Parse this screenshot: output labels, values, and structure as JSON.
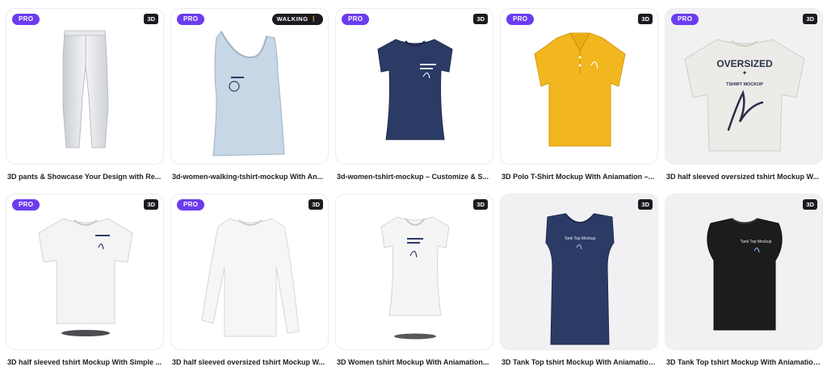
{
  "badges": {
    "pro": "PRO",
    "three_d": "3D",
    "walking": "WALKING",
    "walking_icon": "walking-person-icon"
  },
  "colors": {
    "pro_badge": "#6b3cf0",
    "dark_badge": "#1b1b1f",
    "navy": "#2c3b66",
    "yellow": "#f2b61f",
    "black": "#1c1c1e"
  },
  "cards": [
    {
      "title": "3D pants & Showcase Your Design with Re..."
    },
    {
      "title": "3d-women-walking-tshirt-mockup With An..."
    },
    {
      "title": "3d-women-tshirt-mockup – Customize & S..."
    },
    {
      "title": "3D Polo T-Shirt Mockup With Aniamation –..."
    },
    {
      "title": "3D half sleeved oversized tshirt Mockup W...",
      "print_main": "OVERSIZED",
      "print_sub": "TSHIRT MOCKUP"
    },
    {
      "title": "3D half sleeved tshirt Mockup With Simple ..."
    },
    {
      "title": "3D half sleeved oversized tshirt Mockup W..."
    },
    {
      "title": "3D Women tshirt Mockup With Aniamation..."
    },
    {
      "title": "3D Tank Top tshirt Mockup With Aniamation...",
      "print": "Tank Top Mockup"
    },
    {
      "title": "3D Tank Top tshirt Mockup With Aniamation...",
      "print": "Tank Top Mockup"
    }
  ]
}
